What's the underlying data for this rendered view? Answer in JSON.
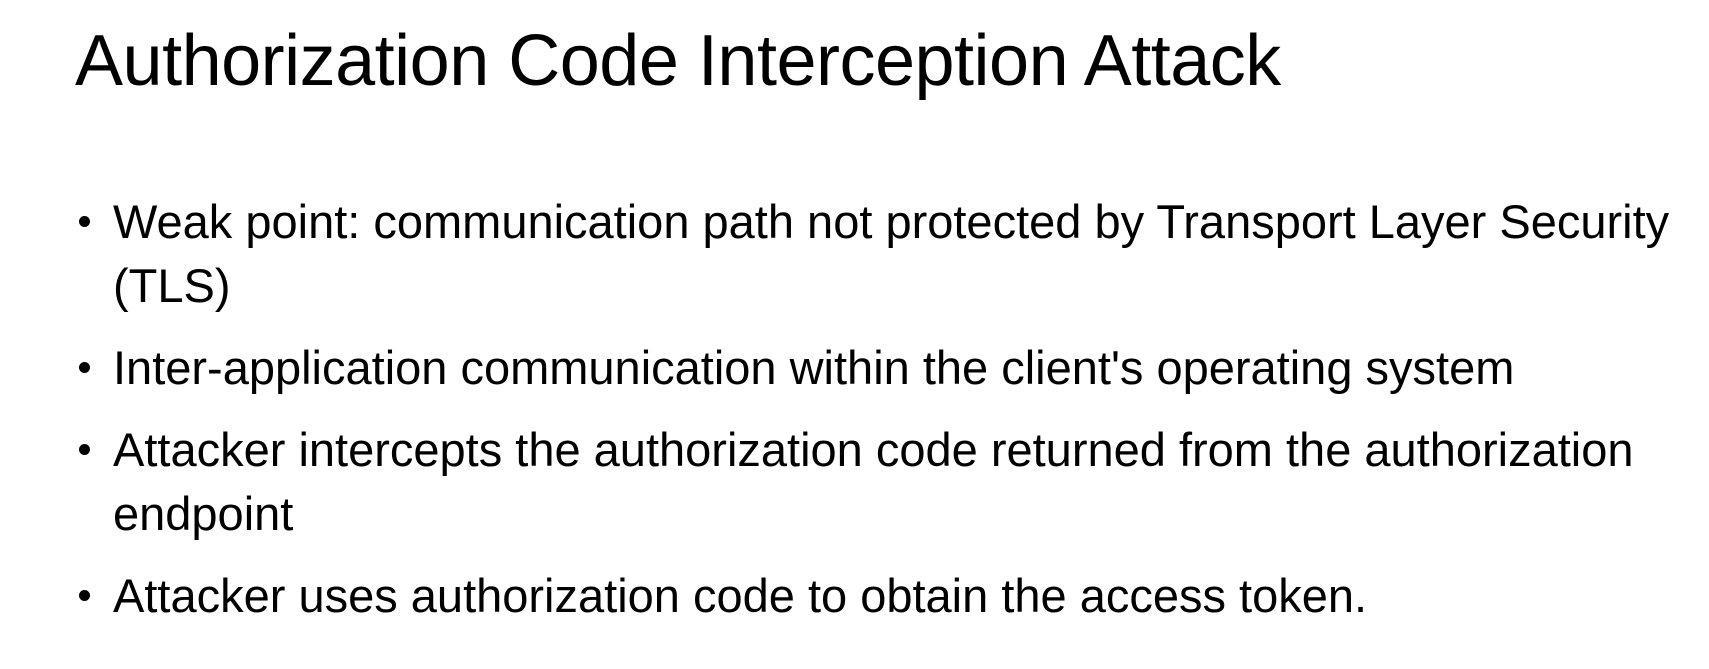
{
  "slide": {
    "title": "Authorization Code Interception Attack",
    "bullets": [
      "Weak point: communication path not protected by Transport Layer Security (TLS)",
      "Inter-application communication within the client's operating system",
      "Attacker intercepts the authorization code returned from the authorization endpoint",
      "Attacker uses authorization code to obtain the access token."
    ]
  }
}
